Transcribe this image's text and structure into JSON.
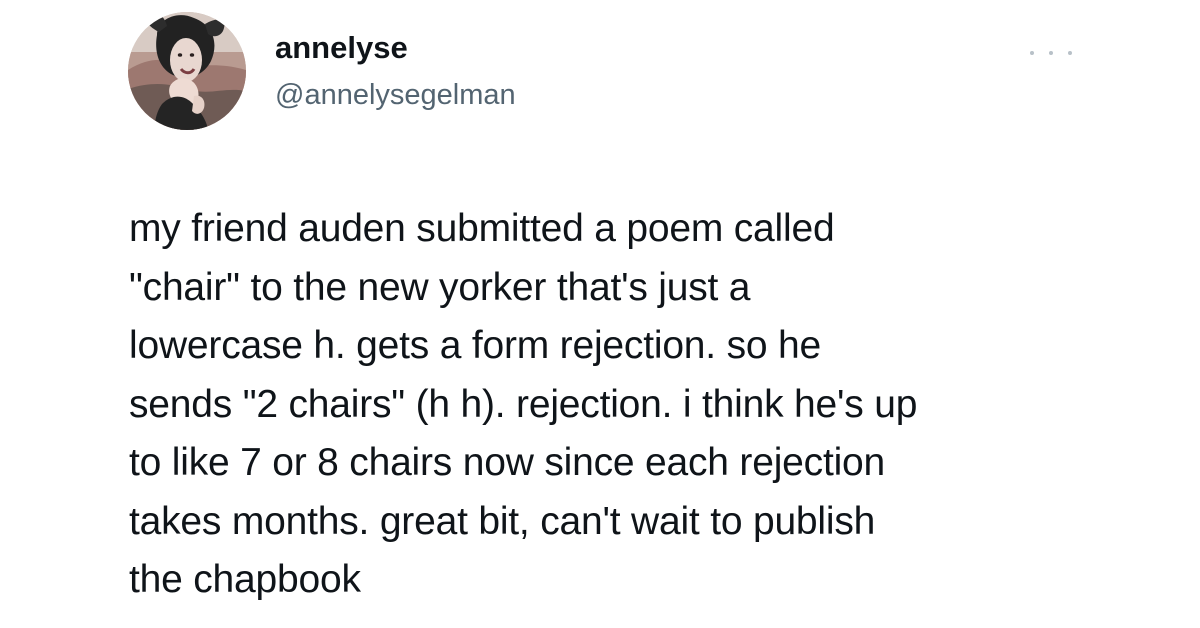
{
  "author": {
    "display_name": "annelyse",
    "handle": "@annelysegelman",
    "avatar_icon": "profile-photo"
  },
  "menu": {
    "icon": "more-options-icon"
  },
  "tweet": {
    "text": "my friend auden submitted a poem called\n\"chair\" to the new yorker that's just a\nlowercase h. gets a form rejection. so he\nsends \"2 chairs\" (h h). rejection. i think he's up\nto like 7 or 8 chairs now since each rejection\ntakes months. great bit, can't wait to publish\nthe chapbook"
  },
  "colors": {
    "text": "#0f1419",
    "secondary_text": "#536471",
    "background": "#ffffff"
  }
}
